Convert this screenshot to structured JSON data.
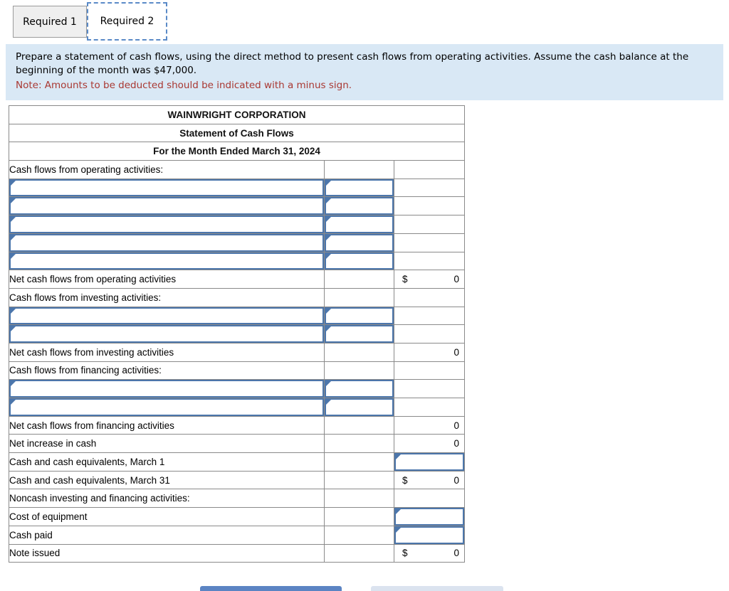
{
  "tabs": [
    {
      "label": "Required 1",
      "active": false
    },
    {
      "label": "Required 2",
      "active": true
    }
  ],
  "instructions": {
    "text": "Prepare a statement of cash flows, using the direct method to present cash flows from operating activities. Assume the cash balance at the beginning of the month was $47,000.",
    "note": "Note: Amounts to be deducted should be indicated with a minus sign."
  },
  "statement": {
    "title": "WAINWRIGHT CORPORATION",
    "subtitle": "Statement of Cash Flows",
    "period": "For the Month Ended March 31, 2024",
    "rows": [
      {
        "label": "Cash flows from operating activities:"
      },
      {},
      {},
      {},
      {},
      {},
      {
        "label": "Net cash flows from operating activities",
        "dollar": "$",
        "value": "0"
      },
      {
        "label": "Cash flows from investing activities:"
      },
      {},
      {},
      {
        "label": "Net cash flows from investing activities",
        "value": "0"
      },
      {
        "label": "Cash flows from financing activities:"
      },
      {},
      {},
      {
        "label": "Net cash flows from financing activities",
        "value": "0"
      },
      {
        "label": "Net increase in cash",
        "value": "0"
      },
      {
        "label": "Cash and cash equivalents, March 1"
      },
      {
        "label": "Cash and cash equivalents, March 31",
        "dollar": "$",
        "value": "0"
      },
      {
        "label": "Noncash investing and financing activities:"
      },
      {
        "label": "Cost of equipment"
      },
      {
        "label": "Cash paid"
      },
      {
        "label": "Note issued",
        "dollar": "$",
        "value": "0"
      }
    ]
  },
  "colors": {
    "header_blue": "#85a8da",
    "input_border_blue": "#4c76ab",
    "note_red": "#a93832",
    "instruction_bg": "#d9e8f5"
  }
}
